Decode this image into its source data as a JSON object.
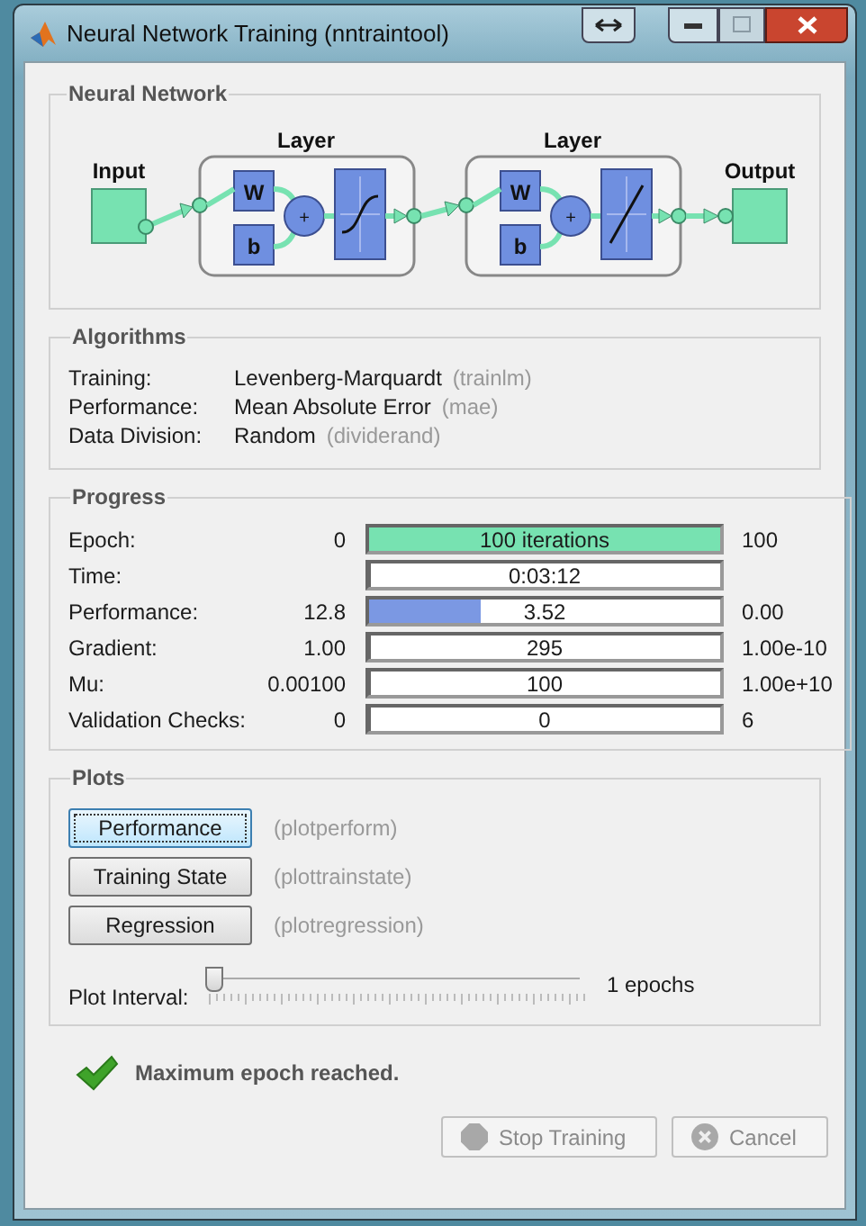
{
  "window": {
    "title": "Neural Network Training (nntraintool)"
  },
  "network": {
    "title": "Neural Network",
    "input_label": "Input",
    "output_label": "Output",
    "layers": [
      {
        "label": "Layer",
        "weight": "W",
        "bias": "b",
        "sum": "+",
        "kind": "sigmoid"
      },
      {
        "label": "Layer",
        "weight": "W",
        "bias": "b",
        "sum": "+",
        "kind": "linear"
      }
    ]
  },
  "algorithms": {
    "title": "Algorithms",
    "rows": [
      {
        "label": "Training:",
        "value": "Levenberg-Marquardt",
        "function": "(trainlm)"
      },
      {
        "label": "Performance:",
        "value": "Mean Absolute Error",
        "function": "(mae)"
      },
      {
        "label": "Data Division:",
        "value": "Random",
        "function": "(dividerand)"
      }
    ]
  },
  "progress": {
    "title": "Progress",
    "rows": [
      {
        "label": "Epoch:",
        "start": "0",
        "reading": "100 iterations",
        "end": "100",
        "level": 1,
        "color": "#77e2b1"
      },
      {
        "label": "Time:",
        "reading": "0:03:12",
        "level": 0
      },
      {
        "label": "Performance:",
        "start": "12.8",
        "reading": "3.52",
        "end": "0.00",
        "level": 0.32,
        "color": "#7b98e3"
      },
      {
        "label": "Gradient:",
        "start": "1.00",
        "reading": "295",
        "end": "1.00e-10",
        "level": 0
      },
      {
        "label": "Mu:",
        "start": "0.00100",
        "reading": "100",
        "end": "1.00e+10",
        "level": 0
      },
      {
        "label": "Validation Checks:",
        "start": "0",
        "reading": "0",
        "end": "6",
        "level": 0
      }
    ]
  },
  "plots": {
    "title": "Plots",
    "buttons": [
      {
        "label": "Performance",
        "function": "(plotperform)",
        "selected": true
      },
      {
        "label": "Training State",
        "function": "(plottrainstate)",
        "selected": false
      },
      {
        "label": "Regression",
        "function": "(plotregression)",
        "selected": false
      }
    ],
    "interval": {
      "label": "Plot Interval:",
      "level": 0,
      "reading": "1 epochs"
    }
  },
  "status": {
    "text": "Maximum epoch reached."
  },
  "buttons": [
    {
      "label": "Stop Training",
      "kind": "stop",
      "disabled": true
    },
    {
      "label": "Cancel",
      "kind": "cancel",
      "disabled": true
    }
  ]
}
